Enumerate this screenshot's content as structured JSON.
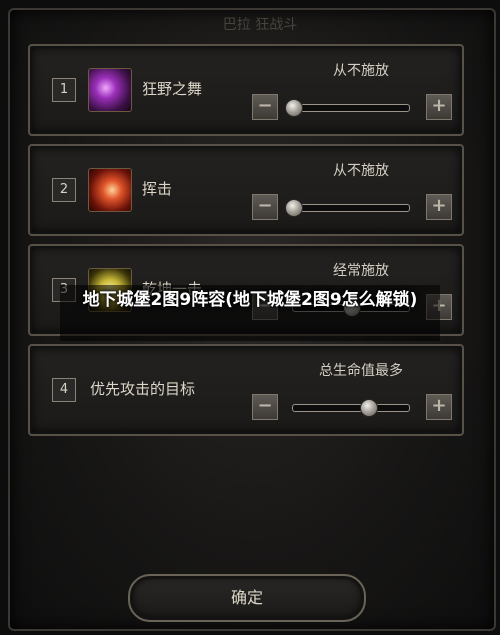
{
  "window": {
    "title": "巴拉 狂战斗"
  },
  "rows": [
    {
      "num": "1",
      "icon": "wild-dance-skill-icon",
      "skill": "狂野之舞",
      "mode": "从不施放",
      "level": 0.0
    },
    {
      "num": "2",
      "icon": "strike-skill-icon",
      "skill": "挥击",
      "mode": "从不施放",
      "level": 0.0
    },
    {
      "num": "3",
      "icon": "golden-skill-icon",
      "skill": "乾坤一击",
      "mode": "经常施放",
      "level": 0.5
    },
    {
      "num": "4",
      "icon": "",
      "skill": "优先攻击的目标",
      "mode": "总生命值最多",
      "level": 0.65
    }
  ],
  "controls": {
    "minus": "−",
    "plus": "+"
  },
  "overlay": {
    "caption": "地下城堡2图9阵容(地下城堡2图9怎么解锁)"
  },
  "confirm": {
    "label": "确定"
  },
  "colors": {
    "frame": "#575148",
    "background": "#181716",
    "text": "#d8d2c4"
  }
}
